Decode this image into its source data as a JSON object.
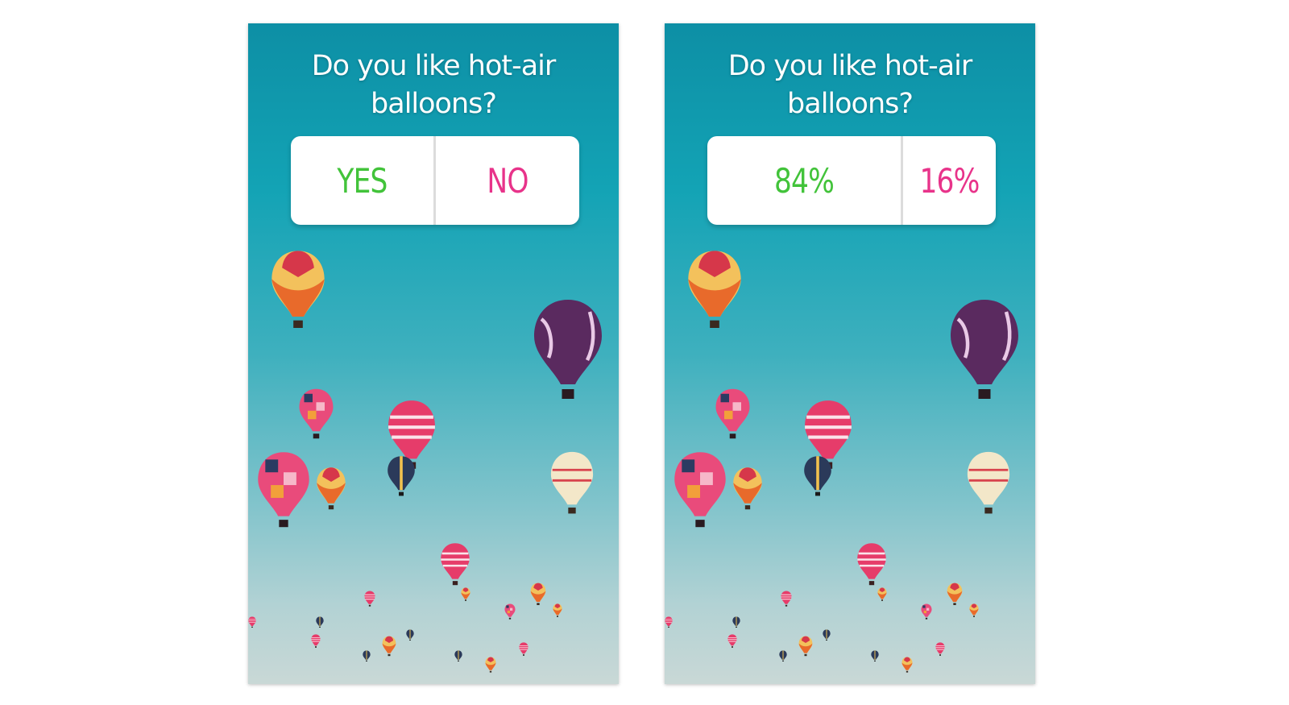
{
  "question": "Do you like hot-air balloons?",
  "left_story": {
    "yes_label": "YES",
    "no_label": "NO"
  },
  "right_story": {
    "yes_result": "84%",
    "no_result": "16%"
  },
  "colors": {
    "yes": "#42c33a",
    "no": "#e8338a",
    "sky_top": "#0d8fa5",
    "sky_bottom": "#c9d8d6"
  }
}
